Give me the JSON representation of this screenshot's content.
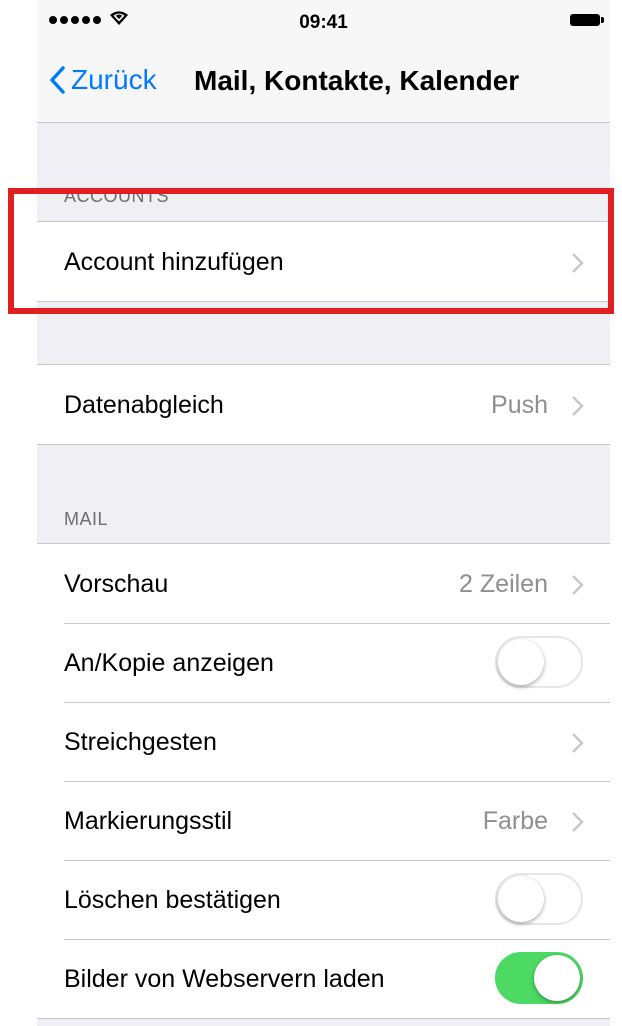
{
  "status_bar": {
    "time": "09:41"
  },
  "nav": {
    "back_label": "Zurück",
    "title": "Mail, Kontakte, Kalender"
  },
  "accounts": {
    "header": "ACCOUNTS",
    "add_account": "Account hinzufügen"
  },
  "sync": {
    "label": "Datenabgleich",
    "value": "Push"
  },
  "mail": {
    "header": "MAIL",
    "preview": {
      "label": "Vorschau",
      "value": "2 Zeilen"
    },
    "show_to_cc": {
      "label": "An/Kopie anzeigen",
      "on": false
    },
    "swipe": {
      "label": "Streichgesten"
    },
    "flag_style": {
      "label": "Markierungsstil",
      "value": "Farbe"
    },
    "ask_before_delete": {
      "label": "Löschen bestätigen",
      "on": false
    },
    "load_remote_images": {
      "label": "Bilder von Webservern laden",
      "on": true
    }
  },
  "colors": {
    "accent": "#007aff",
    "toggle_on": "#4cd964",
    "highlight": "#e02020",
    "background": "#efeff4"
  },
  "icons": [
    "signal-dots-icon",
    "wifi-icon",
    "battery-icon",
    "back-chevron-icon",
    "chevron-right-icon"
  ]
}
